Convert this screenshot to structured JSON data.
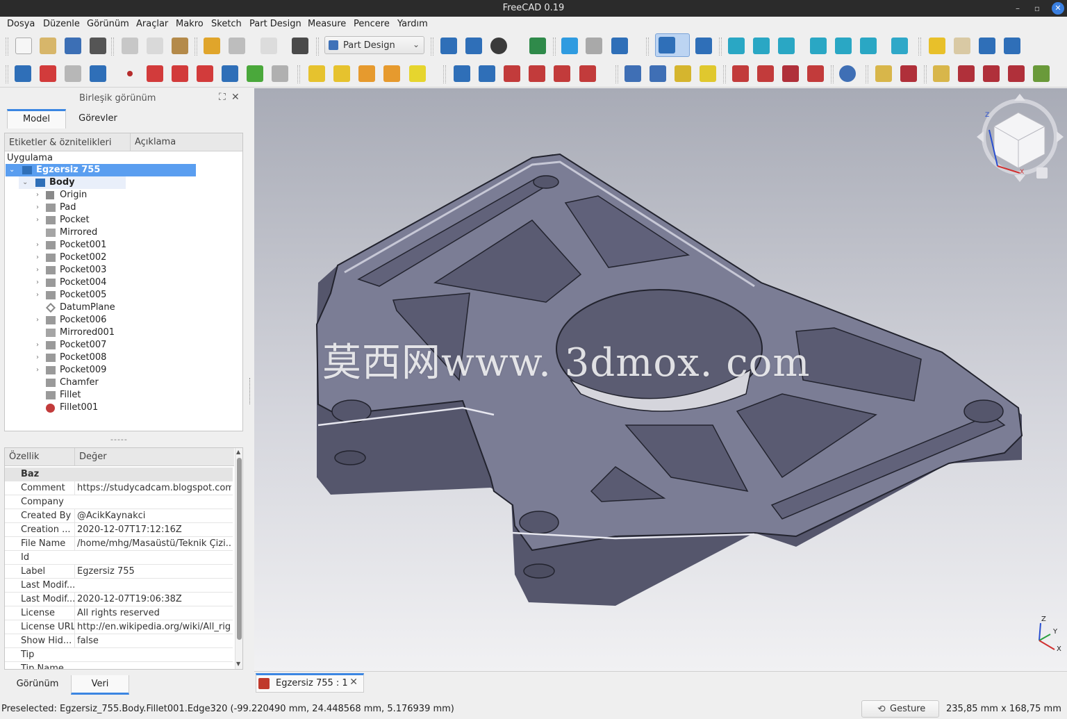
{
  "window": {
    "title": "FreeCAD 0.19"
  },
  "menu": [
    "Dosya",
    "Düzenle",
    "Görünüm",
    "Araçlar",
    "Makro",
    "Sketch",
    "Part Design",
    "Measure",
    "Pencere",
    "Yardım"
  ],
  "workbench_selector": {
    "value": "Part Design"
  },
  "combo_view": {
    "title": "Birleşik görünüm",
    "tabs": [
      "Model",
      "Görevler"
    ],
    "tree_headers": [
      "Etiketler & öznitelikleri",
      "Açıklama"
    ],
    "tree_root": "Uygulama",
    "document": "Egzersiz 755",
    "body": "Body",
    "features": [
      "Origin",
      "Pad",
      "Pocket",
      "Mirrored",
      "Pocket001",
      "Pocket002",
      "Pocket003",
      "Pocket004",
      "Pocket005",
      "DatumPlane",
      "Pocket006",
      "Mirrored001",
      "Pocket007",
      "Pocket008",
      "Pocket009",
      "Chamfer",
      "Fillet",
      "Fillet001"
    ],
    "splitter_label": "-----"
  },
  "property_editor": {
    "headers": [
      "Özellik",
      "Değer"
    ],
    "group": "Baz",
    "rows": [
      {
        "name": "Comment",
        "value": "https://studycadcam.blogspot.com/"
      },
      {
        "name": "Company",
        "value": ""
      },
      {
        "name": "Created By",
        "value": "@AcikKaynakci"
      },
      {
        "name": "Creation ...",
        "value": "2020-12-07T17:12:16Z"
      },
      {
        "name": "File Name",
        "value": "/home/mhg/Masaüstü/Teknik Çizi..."
      },
      {
        "name": "Id",
        "value": ""
      },
      {
        "name": "Label",
        "value": "Egzersiz 755"
      },
      {
        "name": "Last Modif...",
        "value": ""
      },
      {
        "name": "Last Modif...",
        "value": "2020-12-07T19:06:38Z"
      },
      {
        "name": "License",
        "value": "All rights reserved"
      },
      {
        "name": "License URL",
        "value": "http://en.wikipedia.org/wiki/All_rig..."
      },
      {
        "name": "Show Hid...",
        "value": "false"
      },
      {
        "name": "Tip",
        "value": ""
      },
      {
        "name": "Tip Name",
        "value": ""
      }
    ]
  },
  "bottom_tabs": [
    "Görünüm",
    "Veri"
  ],
  "viewport": {
    "watermark": "莫西网www. 3dmox. com",
    "axis_labels": {
      "z": "Z",
      "y": "Y",
      "x": "X"
    }
  },
  "document_tab": {
    "label": "Egzersiz 755 : 1"
  },
  "status": {
    "preselected": "Preselected: Egzersiz_755.Body.Fillet001.Edge320 (-99.220490 mm, 24.448568 mm, 5.176939 mm)",
    "navigation_style": "Gesture",
    "dimensions": "235,85 mm x 168,75 mm"
  },
  "colors": {
    "accent": "#3b86e2",
    "selection": "#5a9ef0",
    "part": "#7b7d95",
    "titlebar": "#2b2b2b"
  },
  "icons": [
    "new-file-icon",
    "open-file-icon",
    "save-icon",
    "print-icon",
    "cut-icon",
    "copy-icon",
    "paste-icon",
    "undo-icon",
    "redo-icon",
    "refresh-icon",
    "whats-this-icon",
    "fit-all-icon",
    "fit-selection-icon",
    "draw-style-icon",
    "bounding-box-icon",
    "back-icon",
    "forward-icon",
    "sync-view-icon",
    "zoom-icon",
    "isometric-icon",
    "front-view-icon",
    "top-view-icon",
    "right-view-icon",
    "rear-view-icon",
    "bottom-view-icon",
    "left-view-icon",
    "measure-icon",
    "part-icon",
    "group-icon",
    "link-icon",
    "link-actions-icon"
  ]
}
